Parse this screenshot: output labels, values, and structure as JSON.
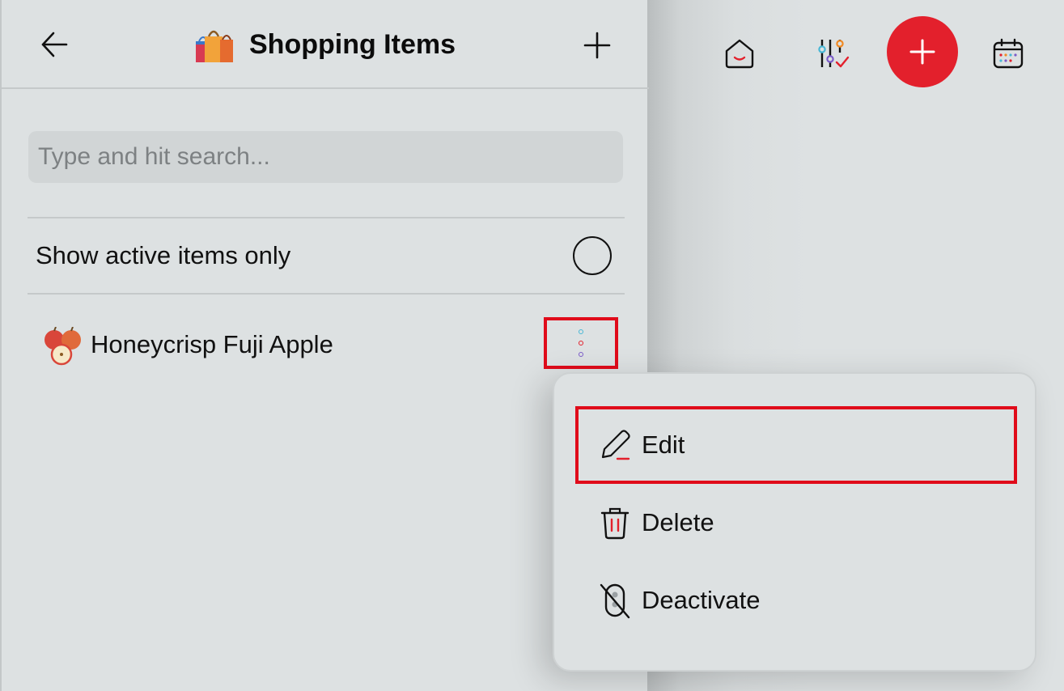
{
  "header": {
    "title": "Shopping Items",
    "title_icon": "shopping-bags-emoji",
    "back_icon": "arrow-left-icon",
    "add_icon": "plus-icon"
  },
  "topbar": {
    "home_icon": "home-icon",
    "filter_icon": "sliders-check-icon",
    "fab_icon": "plus-icon",
    "calendar_icon": "calendar-icon",
    "accent_color": "#e3202c"
  },
  "search": {
    "placeholder": "Type and hit search...",
    "value": ""
  },
  "filter": {
    "label": "Show active items only",
    "checked": false
  },
  "items": [
    {
      "name": "Honeycrisp Fuji Apple",
      "icon": "apples-emoji"
    }
  ],
  "context_menu": {
    "items": [
      {
        "label": "Edit",
        "icon": "pencil-icon",
        "highlighted": true
      },
      {
        "label": "Delete",
        "icon": "trash-icon",
        "highlighted": false
      },
      {
        "label": "Deactivate",
        "icon": "deactivate-icon",
        "highlighted": false
      }
    ]
  }
}
